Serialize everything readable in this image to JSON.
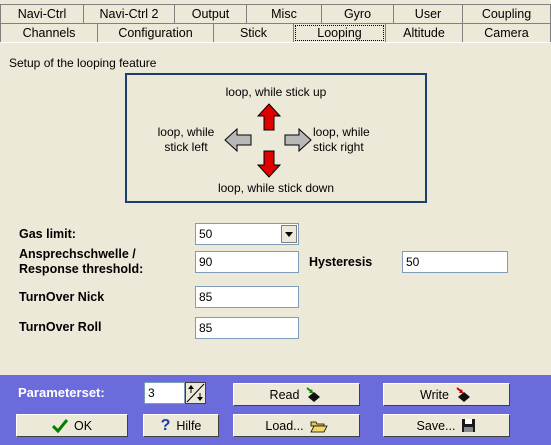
{
  "tabs_row1": [
    "Navi-Ctrl",
    "Navi-Ctrl 2",
    "Output",
    "Misc",
    "Gyro",
    "User",
    "Coupling"
  ],
  "tabs_row2": [
    "Channels",
    "Configuration",
    "Stick",
    "Looping",
    "Altitude",
    "Camera"
  ],
  "active_tab": "Looping",
  "section_title": "Setup of the looping feature",
  "diagram": {
    "up": "loop, while stick up",
    "down": "loop, while stick down",
    "left_line1": "loop, while",
    "left_line2": "stick left",
    "right_line1": "loop, while",
    "right_line2": "stick right",
    "colors": {
      "active_arrow": "#e00000",
      "inactive_arrow": "#b8b8b8",
      "frame": "#1c3f6e"
    }
  },
  "fields": {
    "gas_limit_label": "Gas limit:",
    "gas_limit_value": "50",
    "threshold_label_1": "Ansprechschwelle /",
    "threshold_label_2": "Response threshold:",
    "threshold_value": "90",
    "hysteresis_label": "Hysteresis",
    "hysteresis_value": "50",
    "turnover_nick_label": "TurnOver Nick",
    "turnover_nick_value": "85",
    "turnover_roll_label": "TurnOver Roll",
    "turnover_roll_value": "85"
  },
  "bottom": {
    "parameterset_label": "Parameterset:",
    "parameterset_value": "3",
    "read_label": "Read",
    "write_label": "Write",
    "ok_label": "OK",
    "help_label": "Hilfe",
    "load_label": "Load...",
    "save_label": "Save...",
    "bar_color": "#6b6bdc"
  }
}
